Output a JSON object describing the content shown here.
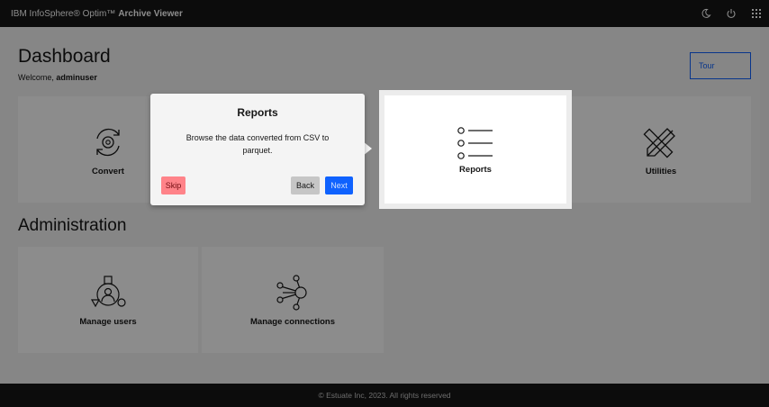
{
  "header": {
    "brand_regular": "IBM InfoSphere® Optim™",
    "brand_bold": "Archive Viewer",
    "icons": [
      "moon-icon",
      "power-icon",
      "app-grid-icon"
    ]
  },
  "dashboard": {
    "title": "Dashboard",
    "welcome_prefix": "Welcome,",
    "username": "adminuser",
    "tour_label": "Tour",
    "tiles": [
      {
        "label": "Convert",
        "icon": "convert-icon"
      },
      {
        "label": "Reports",
        "icon": "list-icon"
      },
      {
        "label": "Utilities",
        "icon": "tools-icon"
      }
    ]
  },
  "administration": {
    "title": "Administration",
    "tiles": [
      {
        "label": "Manage users",
        "icon": "users-icon"
      },
      {
        "label": "Manage connections",
        "icon": "connections-icon"
      }
    ]
  },
  "tour_popover": {
    "title": "Reports",
    "body": "Browse the data converted from CSV to parquet.",
    "skip_label": "Skip",
    "back_label": "Back",
    "next_label": "Next"
  },
  "footer": {
    "copyright": "© Estuate Inc, 2023.  All rights reserved"
  },
  "colors": {
    "primary": "#0f62fe",
    "header_bg": "#161616",
    "skip_bg": "#ff8389"
  }
}
